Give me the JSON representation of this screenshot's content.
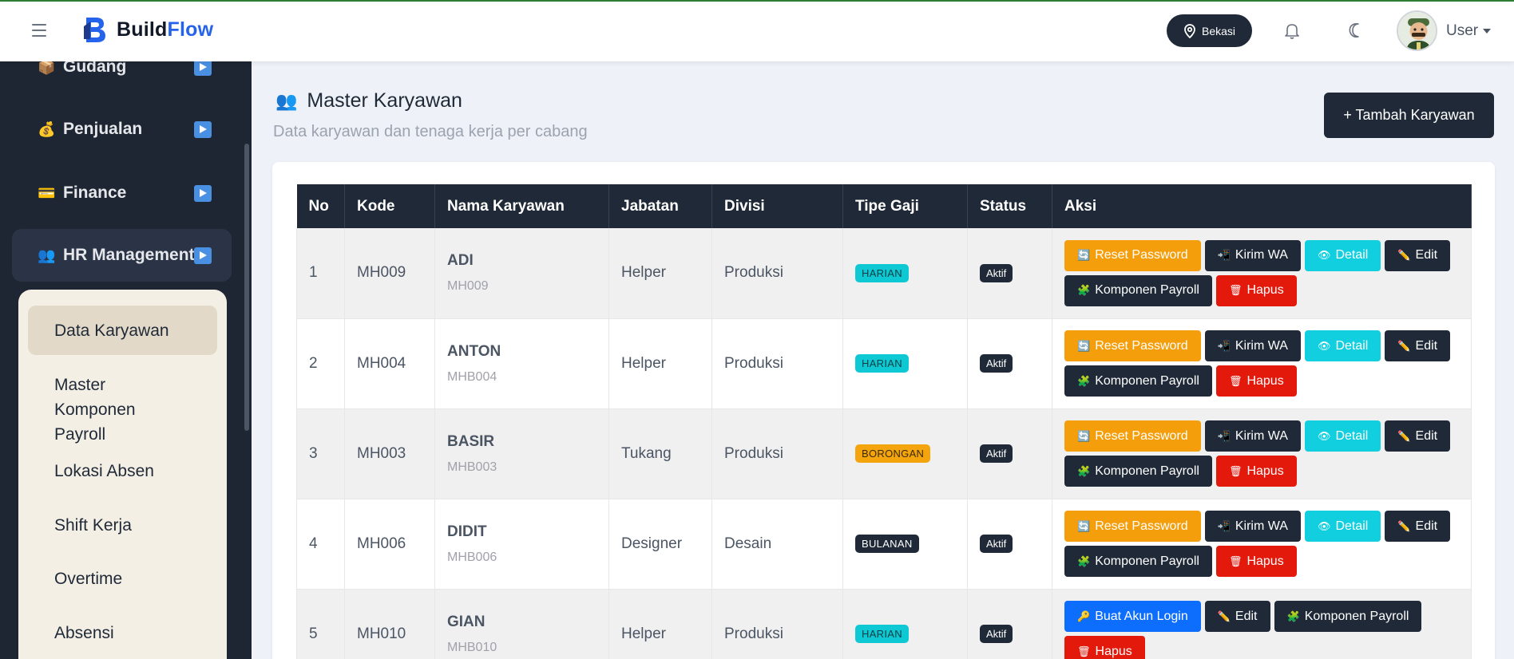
{
  "header": {
    "brand_prefix": "Build",
    "brand_suffix": "Flow",
    "location": "Bekasi",
    "user_label": "User"
  },
  "sidebar": {
    "items": [
      {
        "label": "Gudang",
        "icon": "package-icon"
      },
      {
        "label": "Penjualan",
        "icon": "money-bag-icon"
      },
      {
        "label": "Finance",
        "icon": "credit-card-icon"
      },
      {
        "label": "HR Management",
        "icon": "people-icon"
      }
    ],
    "submenu": [
      "Data Karyawan",
      "Master Komponen Payroll",
      "Lokasi Absen",
      "Shift Kerja",
      "Overtime",
      "Absensi"
    ]
  },
  "page": {
    "title": "Master Karyawan",
    "subtitle": "Data karyawan dan tenaga kerja per cabang",
    "add_button": "+ Tambah Karyawan"
  },
  "table": {
    "headers": [
      "No",
      "Kode",
      "Nama Karyawan",
      "Jabatan",
      "Divisi",
      "Tipe Gaji",
      "Status",
      "Aksi"
    ],
    "rows": [
      {
        "no": "1",
        "kode": "MH009",
        "nama": "ADI",
        "sub": "MH009",
        "jabatan": "Helper",
        "divisi": "Produksi",
        "tipe": "HARIAN",
        "status": "Aktif"
      },
      {
        "no": "2",
        "kode": "MH004",
        "nama": "ANTON",
        "sub": "MHB004",
        "jabatan": "Helper",
        "divisi": "Produksi",
        "tipe": "HARIAN",
        "status": "Aktif"
      },
      {
        "no": "3",
        "kode": "MH003",
        "nama": "BASIR",
        "sub": "MHB003",
        "jabatan": "Tukang",
        "divisi": "Produksi",
        "tipe": "BORONGAN",
        "status": "Aktif"
      },
      {
        "no": "4",
        "kode": "MH006",
        "nama": "DIDIT",
        "sub": "MHB006",
        "jabatan": "Designer",
        "divisi": "Desain",
        "tipe": "BULANAN",
        "status": "Aktif"
      },
      {
        "no": "5",
        "kode": "MH010",
        "nama": "GIAN",
        "sub": "MHB010",
        "jabatan": "Helper",
        "divisi": "Produksi",
        "tipe": "HARIAN",
        "status": "Aktif"
      }
    ],
    "actions": {
      "reset_password": "Reset Password",
      "kirim_wa": "Kirim WA",
      "detail": "Detail",
      "edit": "Edit",
      "komponen_payroll": "Komponen Payroll",
      "hapus": "Hapus",
      "buat_akun_login": "Buat Akun Login"
    }
  },
  "colors": {
    "sidebar_bg": "#1e2533",
    "header_dark": "#1f2937",
    "brand_blue": "#2563eb",
    "warning": "#f59e0b",
    "info": "#12cfe0",
    "danger": "#e3190c",
    "primary": "#0d6efd"
  }
}
